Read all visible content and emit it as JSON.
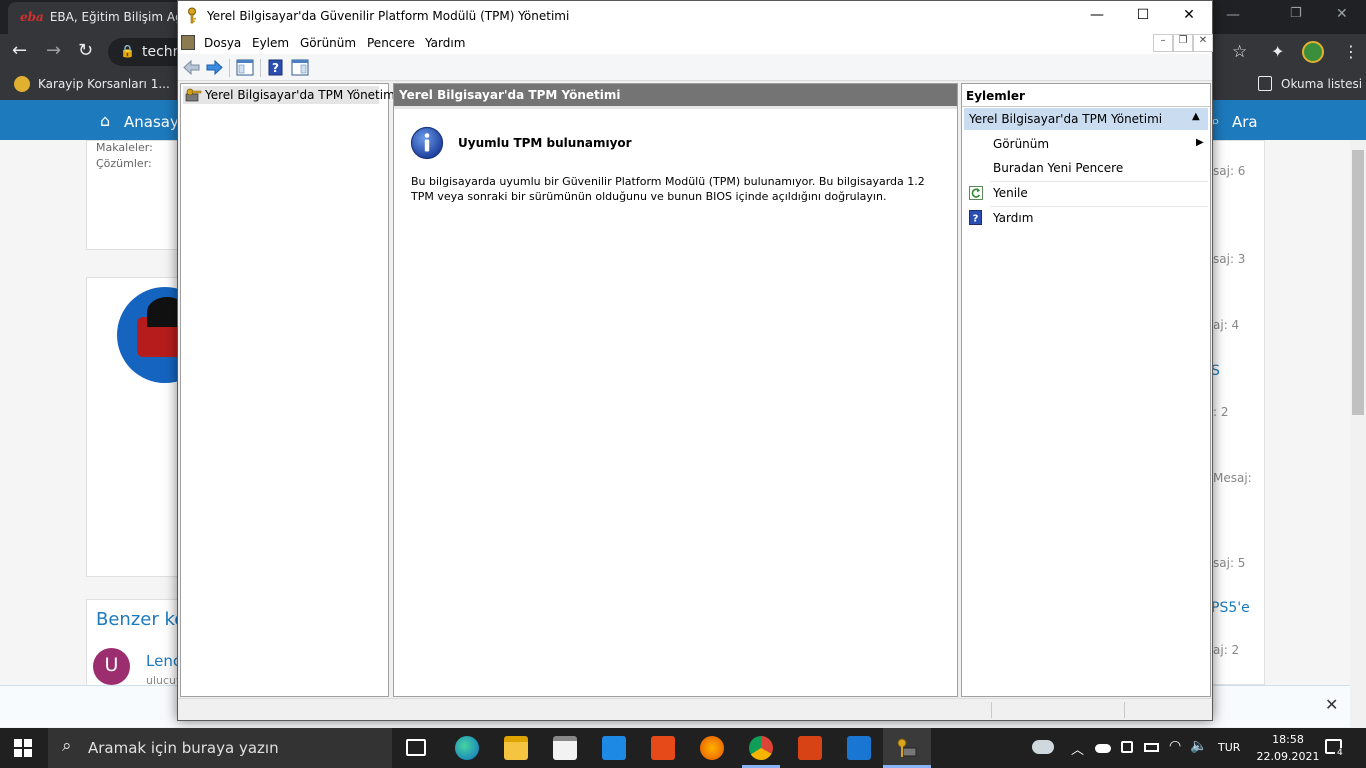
{
  "browser": {
    "tab_title": "EBA, Eğitim Bilişim Ağı, D",
    "tab_logo": "eba",
    "omnibox_text": "techn",
    "bookmark_1": "Karayip Korsanları 1...",
    "reading_list": "Okuma listesi",
    "site_nav_home": "Anasayfa",
    "site_nav_search": "Ara",
    "site_sidebar": [
      "Makaleler:",
      "Çözümler:"
    ],
    "similar_heading": "Benzer ko",
    "similar_user_initial": "U",
    "similar_link": "Lenc",
    "similar_user": "ulucuv",
    "right_stats": [
      "saj: 6",
      "saj: 3",
      "aj: 4",
      "S",
      ": 2",
      "Mesaj:",
      "saj: 5",
      "PS5'e",
      "aj: 2"
    ]
  },
  "window": {
    "title": "Yerel Bilgisayar'da Güvenilir Platform Modülü (TPM) Yönetimi",
    "minimize": "—",
    "maximize": "☐",
    "close": "✕"
  },
  "menu": {
    "items": [
      "Dosya",
      "Eylem",
      "Görünüm",
      "Pencere",
      "Yardım"
    ],
    "inner_min": "–",
    "inner_restore": "❐",
    "inner_close": "✕"
  },
  "tree": {
    "root_label": "Yerel Bilgisayar'da TPM Yönetimi"
  },
  "center": {
    "header": "Yerel Bilgisayar'da TPM Yönetimi",
    "info_title": "Uyumlu TPM bulunamıyor",
    "info_line1": "Bu bilgisayarda uyumlu bir Güvenilir Platform Modülü (TPM) bulunamıyor. Bu bilgisayarda 1.2",
    "info_line2": "TPM veya sonraki bir sürümünün olduğunu ve bunun BIOS içinde açıldığını doğrulayın."
  },
  "actions": {
    "header": "Eylemler",
    "section": "Yerel Bilgisayar'da TPM Yönetimi",
    "items": [
      "Görünüm",
      "Buradan Yeni Pencere",
      "Yenile",
      "Yardım"
    ]
  },
  "taskbar": {
    "search_placeholder": "Aramak için buraya yazın",
    "lang": "TUR",
    "time": "18:58",
    "date": "22.09.2021",
    "notif_count": "4"
  },
  "colors": {
    "site_blue": "#1d7abd",
    "actions_selected": "#c9dcf0",
    "center_header": "#747474",
    "taskbar": "#202020"
  }
}
